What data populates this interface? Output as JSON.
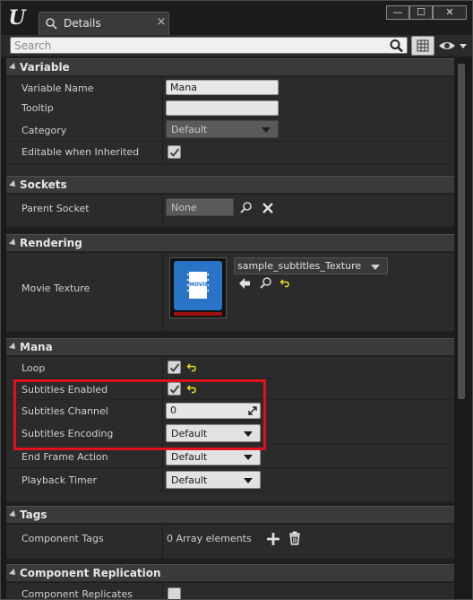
{
  "tab": {
    "title": "Details",
    "close": "×"
  },
  "window_buttons": {
    "minimize": "—",
    "maximize": "☐",
    "close": "✕"
  },
  "search": {
    "placeholder": "Search",
    "value": ""
  },
  "sections": {
    "variable": {
      "title": "Variable",
      "rows": {
        "variable_name": {
          "label": "Variable Name",
          "value": "Mana"
        },
        "tooltip": {
          "label": "Tooltip",
          "value": ""
        },
        "category": {
          "label": "Category",
          "value": "Default"
        },
        "editable_when_inherited": {
          "label": "Editable when Inherited",
          "checked": true
        }
      }
    },
    "sockets": {
      "title": "Sockets",
      "rows": {
        "parent_socket": {
          "label": "Parent Socket",
          "value": "None"
        }
      }
    },
    "rendering": {
      "title": "Rendering",
      "rows": {
        "movie_texture": {
          "label": "Movie Texture",
          "asset": "sample_subtitles_Texture",
          "thumbnail_text": "MOVIE"
        }
      }
    },
    "mana": {
      "title": "Mana",
      "rows": {
        "loop": {
          "label": "Loop",
          "checked": true
        },
        "subtitles_enabled": {
          "label": "Subtitles Enabled",
          "checked": true
        },
        "subtitles_channel": {
          "label": "Subtitles Channel",
          "value": "0"
        },
        "subtitles_encoding": {
          "label": "Subtitles Encoding",
          "value": "Default"
        },
        "end_frame_action": {
          "label": "End Frame Action",
          "value": "Default"
        },
        "playback_timer": {
          "label": "Playback Timer",
          "value": "Default"
        }
      }
    },
    "tags": {
      "title": "Tags",
      "rows": {
        "component_tags": {
          "label": "Component Tags",
          "value": "0 Array elements"
        }
      }
    },
    "component_replication": {
      "title": "Component Replication",
      "rows": {
        "component_replicates": {
          "label": "Component Replicates",
          "checked": false
        }
      }
    }
  },
  "colors": {
    "highlight": "#e0101d",
    "reset_arrow": "#f0e020",
    "thumbnail_blue": "#2a74c8"
  }
}
